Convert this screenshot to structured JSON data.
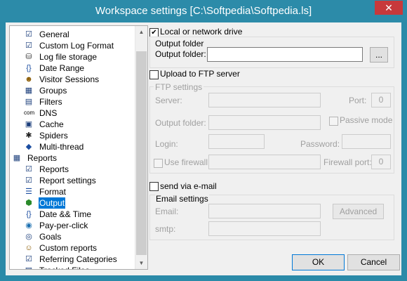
{
  "window": {
    "title": "Workspace settings [C:\\Softpedia\\Softpedia.ls]",
    "close_glyph": "✕",
    "title_bar_color": "#2c8ba9",
    "close_color": "#c7393b"
  },
  "tree": {
    "items": [
      {
        "label": "General",
        "icon": "settings-icon",
        "glyph": "☑",
        "level": 1
      },
      {
        "label": "Custom Log Format",
        "icon": "settings-icon",
        "glyph": "☑",
        "level": 1
      },
      {
        "label": "Log file storage",
        "icon": "database-icon",
        "glyph": "⛁",
        "level": 1
      },
      {
        "label": "Date Range",
        "icon": "braces-icon",
        "glyph": "{}",
        "level": 1
      },
      {
        "label": "Visitor Sessions",
        "icon": "visitor-icon",
        "glyph": "☻",
        "level": 1
      },
      {
        "label": "Groups",
        "icon": "grid-icon",
        "glyph": "▦",
        "level": 1
      },
      {
        "label": "Filters",
        "icon": "filter-icon",
        "glyph": "▤",
        "level": 1
      },
      {
        "label": "DNS",
        "icon": "dns-icon",
        "glyph": "com",
        "level": 1
      },
      {
        "label": "Cache",
        "icon": "cache-icon",
        "glyph": "▣",
        "level": 1
      },
      {
        "label": "Spiders",
        "icon": "spider-icon",
        "glyph": "✱",
        "level": 1
      },
      {
        "label": "Multi-thread",
        "icon": "thread-icon",
        "glyph": "◆",
        "level": 1
      },
      {
        "label": "Reports",
        "icon": "reports-folder-icon",
        "glyph": "▦",
        "level": 0
      },
      {
        "label": "Reports",
        "icon": "settings-icon",
        "glyph": "☑",
        "level": 1
      },
      {
        "label": "Report settings",
        "icon": "settings-icon",
        "glyph": "☑",
        "level": 1
      },
      {
        "label": "Format",
        "icon": "list-icon",
        "glyph": "☰",
        "level": 1
      },
      {
        "label": "Output",
        "icon": "output-icon",
        "glyph": "⬢",
        "level": 1,
        "selected": true
      },
      {
        "label": "Date && Time",
        "icon": "braces-icon",
        "glyph": "{}",
        "level": 1
      },
      {
        "label": "Pay-per-click",
        "icon": "globe-icon",
        "glyph": "◉",
        "level": 1
      },
      {
        "label": "Goals",
        "icon": "goal-icon",
        "glyph": "◎",
        "level": 1
      },
      {
        "label": "Custom reports",
        "icon": "custom-report-icon",
        "glyph": "☺",
        "level": 1
      },
      {
        "label": "Referring Categories",
        "icon": "settings-icon",
        "glyph": "☑",
        "level": 1
      },
      {
        "label": "Tracked Files",
        "icon": "file-icon",
        "glyph": "▤",
        "level": 1
      }
    ],
    "scroll_up": "▲",
    "scroll_down": "▼"
  },
  "local": {
    "checkbox_label": "Local or network drive",
    "checked": true,
    "group_label": "Output folder",
    "folder_label": "Output folder:",
    "folder_value": "",
    "browse_label": "..."
  },
  "ftp": {
    "checkbox_label": "Upload to FTP server",
    "checked": false,
    "group_label": "FTP settings",
    "server_label": "Server:",
    "port_label": "Port:",
    "port_value": "0",
    "output_folder_label": "Output folder:",
    "passive_label": "Passive mode",
    "login_label": "Login:",
    "password_label": "Password:",
    "firewall_label": "Use firewall",
    "firewall_port_label": "Firewall port:",
    "firewall_port_value": "0"
  },
  "email": {
    "checkbox_label": "send via e-mail",
    "checked": false,
    "group_label": "Email settings",
    "email_label": "Email:",
    "advanced_label": "Advanced",
    "smtp_label": "smtp:"
  },
  "buttons": {
    "ok": "OK",
    "cancel": "Cancel"
  }
}
